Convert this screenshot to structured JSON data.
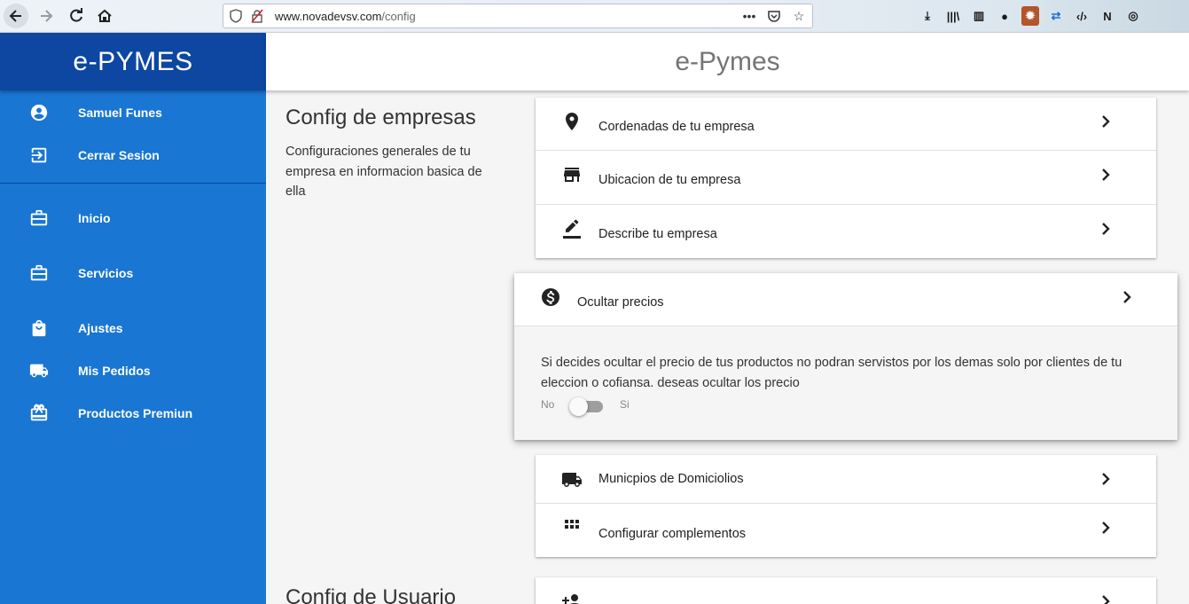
{
  "browser": {
    "url_host": "www.novadevsv.com",
    "url_path": "/config"
  },
  "sidebar": {
    "brand": "e-PYMES",
    "user": {
      "label": "Samuel Funes",
      "icon": "account-circle-icon"
    },
    "logout": {
      "label": "Cerrar Sesion",
      "icon": "logout-icon"
    },
    "items": [
      {
        "label": "Inicio",
        "icon": "briefcase-icon"
      },
      {
        "label": "Servicios",
        "icon": "briefcase-icon"
      },
      {
        "label": "Ajustes",
        "icon": "shopping-bag-icon"
      },
      {
        "label": "Mis Pedidos",
        "icon": "truck-icon"
      },
      {
        "label": "Productos Premiun",
        "icon": "gift-card-icon"
      }
    ]
  },
  "appbar": {
    "title": "e-Pymes"
  },
  "company": {
    "title": "Config de empresas",
    "description": "Configuraciones generales de tu empresa en informacion basica de ella",
    "items": [
      {
        "label": "Cordenadas de tu empresa",
        "icon": "location-pin-icon"
      },
      {
        "label": "Ubicacion de tu empresa",
        "icon": "store-icon"
      },
      {
        "label": "Describe tu empresa",
        "icon": "edit-pencil-icon"
      }
    ],
    "hide_prices": {
      "label": "Ocultar precios",
      "icon": "dollar-circle-icon",
      "body": "Si decides ocultar el precio de tus productos no podran servistos por los demas solo por clientes de tu eleccion o cofiansa. deseas ocultar los precio",
      "toggle_off_label": "No",
      "toggle_on_label": "Si",
      "toggle_on": false
    },
    "items2": [
      {
        "label": "Municpios de Domiciolios",
        "icon": "truck-icon"
      },
      {
        "label": "Configurar complementos",
        "icon": "grid-icon"
      }
    ]
  },
  "user_section": {
    "title": "Config de Usuario"
  }
}
